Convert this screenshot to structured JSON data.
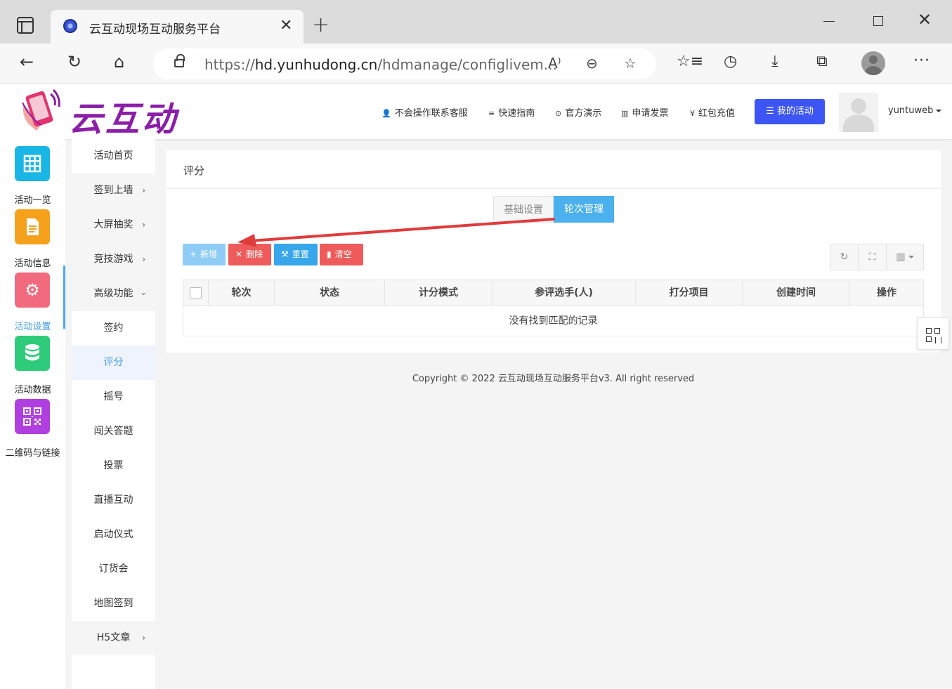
{
  "browser": {
    "tab_title": "云互动现场互动服务平台",
    "url_prefix": "https://",
    "url_host": "hd.yunhudong.cn",
    "url_path": "/hdmanage/configlivem..."
  },
  "header": {
    "logo_text": "云互动",
    "nav": [
      "不会操作联系客服",
      "快速指南",
      "官方演示",
      "申请发票",
      "红包充值"
    ],
    "my_activity": "我的活动",
    "username": "yuntuweb"
  },
  "icon_sidebar": [
    {
      "label": "活动一览",
      "icon": "grid-icon",
      "color": "#1ab6e6"
    },
    {
      "label": "活动信息",
      "icon": "document-icon",
      "color": "#f5a11b"
    },
    {
      "label": "活动设置",
      "icon": "gear-icon",
      "color": "#f26a7d"
    },
    {
      "label": "活动数据",
      "icon": "database-icon",
      "color": "#2dcb7a"
    },
    {
      "label": "二维码与链接",
      "icon": "qrcode-icon",
      "color": "#b03fe0"
    }
  ],
  "submenu": [
    {
      "label": "活动首页"
    },
    {
      "label": "签到上墙",
      "arrow": "›"
    },
    {
      "label": "大屏抽奖",
      "arrow": "›"
    },
    {
      "label": "竞技游戏",
      "arrow": "›"
    },
    {
      "label": "高级功能",
      "arrow": "‹"
    },
    {
      "label": "签约"
    },
    {
      "label": "评分"
    },
    {
      "label": "摇号"
    },
    {
      "label": "闯关答题"
    },
    {
      "label": "投票"
    },
    {
      "label": "直播互动"
    },
    {
      "label": "启动仪式"
    },
    {
      "label": "订货会"
    },
    {
      "label": "地图签到"
    },
    {
      "label": "H5文章",
      "arrow": "›"
    }
  ],
  "panel": {
    "title": "评分",
    "tab_basic": "基础设置",
    "tab_round": "轮次管理",
    "buttons": {
      "add": "新增",
      "delete": "删除",
      "reset": "重置",
      "clear": "清空"
    },
    "columns": [
      "轮次",
      "状态",
      "计分模式",
      "参评选手(人)",
      "打分项目",
      "创建时间",
      "操作"
    ],
    "empty_text": "没有找到匹配的记录"
  },
  "footer": "Copyright © 2022 云互动现场互动服务平台v3. All right reserved",
  "colors": {
    "accent": "#3d55f5",
    "tab_active": "#4ab0ee",
    "danger": "#ef5b5b",
    "annotation_arrow": "#e03c3c"
  }
}
